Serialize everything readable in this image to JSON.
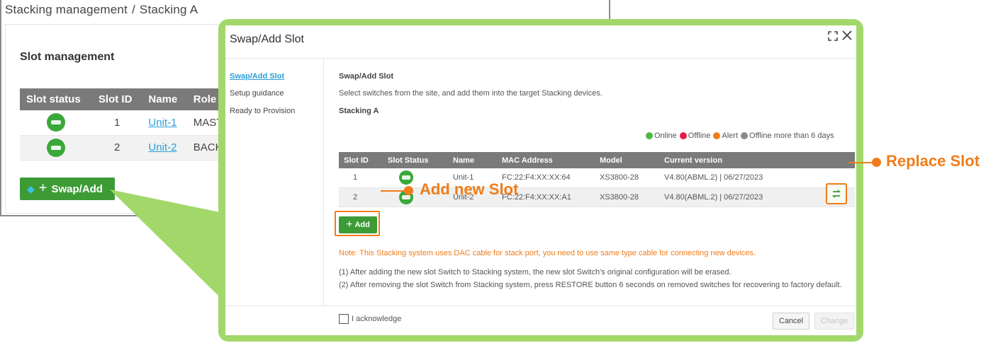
{
  "colors": {
    "accent_green": "#3d9b35",
    "frame_green": "#a2d86a",
    "annotation_orange": "#f07d1a",
    "link_blue": "#2a9fd8",
    "table_header": "#7a7a7a"
  },
  "background": {
    "breadcrumb": {
      "parent": "Stacking management",
      "separator": "/",
      "current": "Stacking A"
    },
    "panel_title": "Slot management",
    "table": {
      "headers": [
        "Slot status",
        "Slot ID",
        "Name",
        "Role"
      ],
      "rows": [
        {
          "slot_id": "1",
          "name": "Unit-1",
          "role": "MAST"
        },
        {
          "slot_id": "2",
          "name": "Unit-2",
          "role": "BACK"
        }
      ]
    },
    "swap_button": {
      "icon": "gem-icon",
      "label": "Swap/Add"
    }
  },
  "dialog": {
    "title": "Swap/Add Slot",
    "nav": [
      "Swap/Add Slot",
      "Setup guidance",
      "Ready to Provision"
    ],
    "content": {
      "heading": "Swap/Add Slot",
      "description": "Select switches from the site, and add them into the target Stacking devices.",
      "stack_name": "Stacking A",
      "legend": [
        {
          "label": "Online",
          "color": "#4db848"
        },
        {
          "label": "Offline",
          "color": "#e8194a"
        },
        {
          "label": "Alert",
          "color": "#f07d1a"
        },
        {
          "label": "Offline more than 6 days",
          "color": "#8a8a8a"
        }
      ],
      "table": {
        "headers": [
          "Slot ID",
          "Slot Status",
          "Name",
          "MAC Address",
          "Model",
          "Current version"
        ],
        "rows": [
          {
            "slot_id": "1",
            "name": "Unit-1",
            "mac": "FC:22:F4:XX:XX:64",
            "model": "XS3800-28",
            "version": "V4.80(ABML.2) | 06/27/2023"
          },
          {
            "slot_id": "2",
            "name": "Unit-2",
            "mac": "FC:22:F4:XX:XX:A1",
            "model": "XS3800-28",
            "version": "V4.80(ABML.2) | 06/27/2023"
          }
        ]
      },
      "add_button": "Add",
      "note": "Note: This Stacking system uses DAC cable for stack port, you need to use same type cable for connecting new devices.",
      "info": [
        "(1) After adding the new slot Switch to Stacking system, the new slot Switch's original configuration will be erased.",
        "(2) After removing the slot Switch from Stacking system, press RESTORE button 6 seconds on removed switches for recovering to factory default."
      ],
      "acknowledge": "I acknowledge"
    },
    "footer": {
      "cancel": "Cancel",
      "change": "Change"
    }
  },
  "annotations": {
    "replace_slot": "Replace Slot",
    "add_new_slot": "Add new Slot"
  }
}
